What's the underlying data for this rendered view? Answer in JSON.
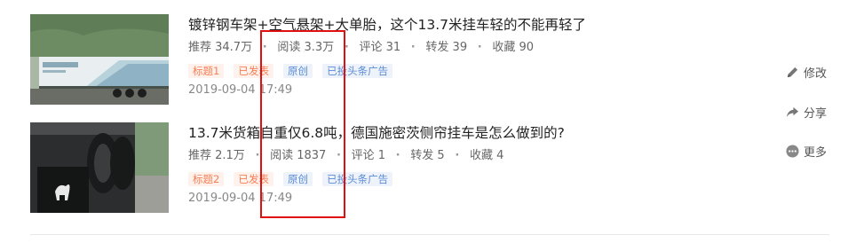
{
  "articles": [
    {
      "title": "镀锌钢车架+空气悬架+大单胎，这个13.7米挂车轻的不能再轻了",
      "stats": {
        "recommend": "推荐 34.7万",
        "reads": "阅读 3.3万",
        "comments": "评论 31",
        "shares": "转发 39",
        "favorites": "收藏 90"
      },
      "tags": {
        "label": "标题1",
        "status": "已发表",
        "original": "原创",
        "ad": "已投头条广告"
      },
      "date": "2019-09-04 17:49"
    },
    {
      "title": "13.7米货箱自重仅6.8吨，德国施密茨侧帘挂车是怎么做到的?",
      "stats": {
        "recommend": "推荐 2.1万",
        "reads": "阅读 1837",
        "comments": "评论 1",
        "shares": "转发 5",
        "favorites": "收藏 4"
      },
      "tags": {
        "label": "标题2",
        "status": "已发表",
        "original": "原创",
        "ad": "已投头条广告"
      },
      "date": "2019-09-04 17:49"
    }
  ],
  "actions": {
    "edit": "修改",
    "share": "分享",
    "more": "更多"
  },
  "separator": "·",
  "icons": {
    "edit": "pencil-icon",
    "share": "share-arrow-icon",
    "more": "more-dots-icon"
  },
  "colors": {
    "highlight": "#e01010",
    "tag_warm": "#f57f55",
    "tag_cool": "#5a8bd6"
  }
}
